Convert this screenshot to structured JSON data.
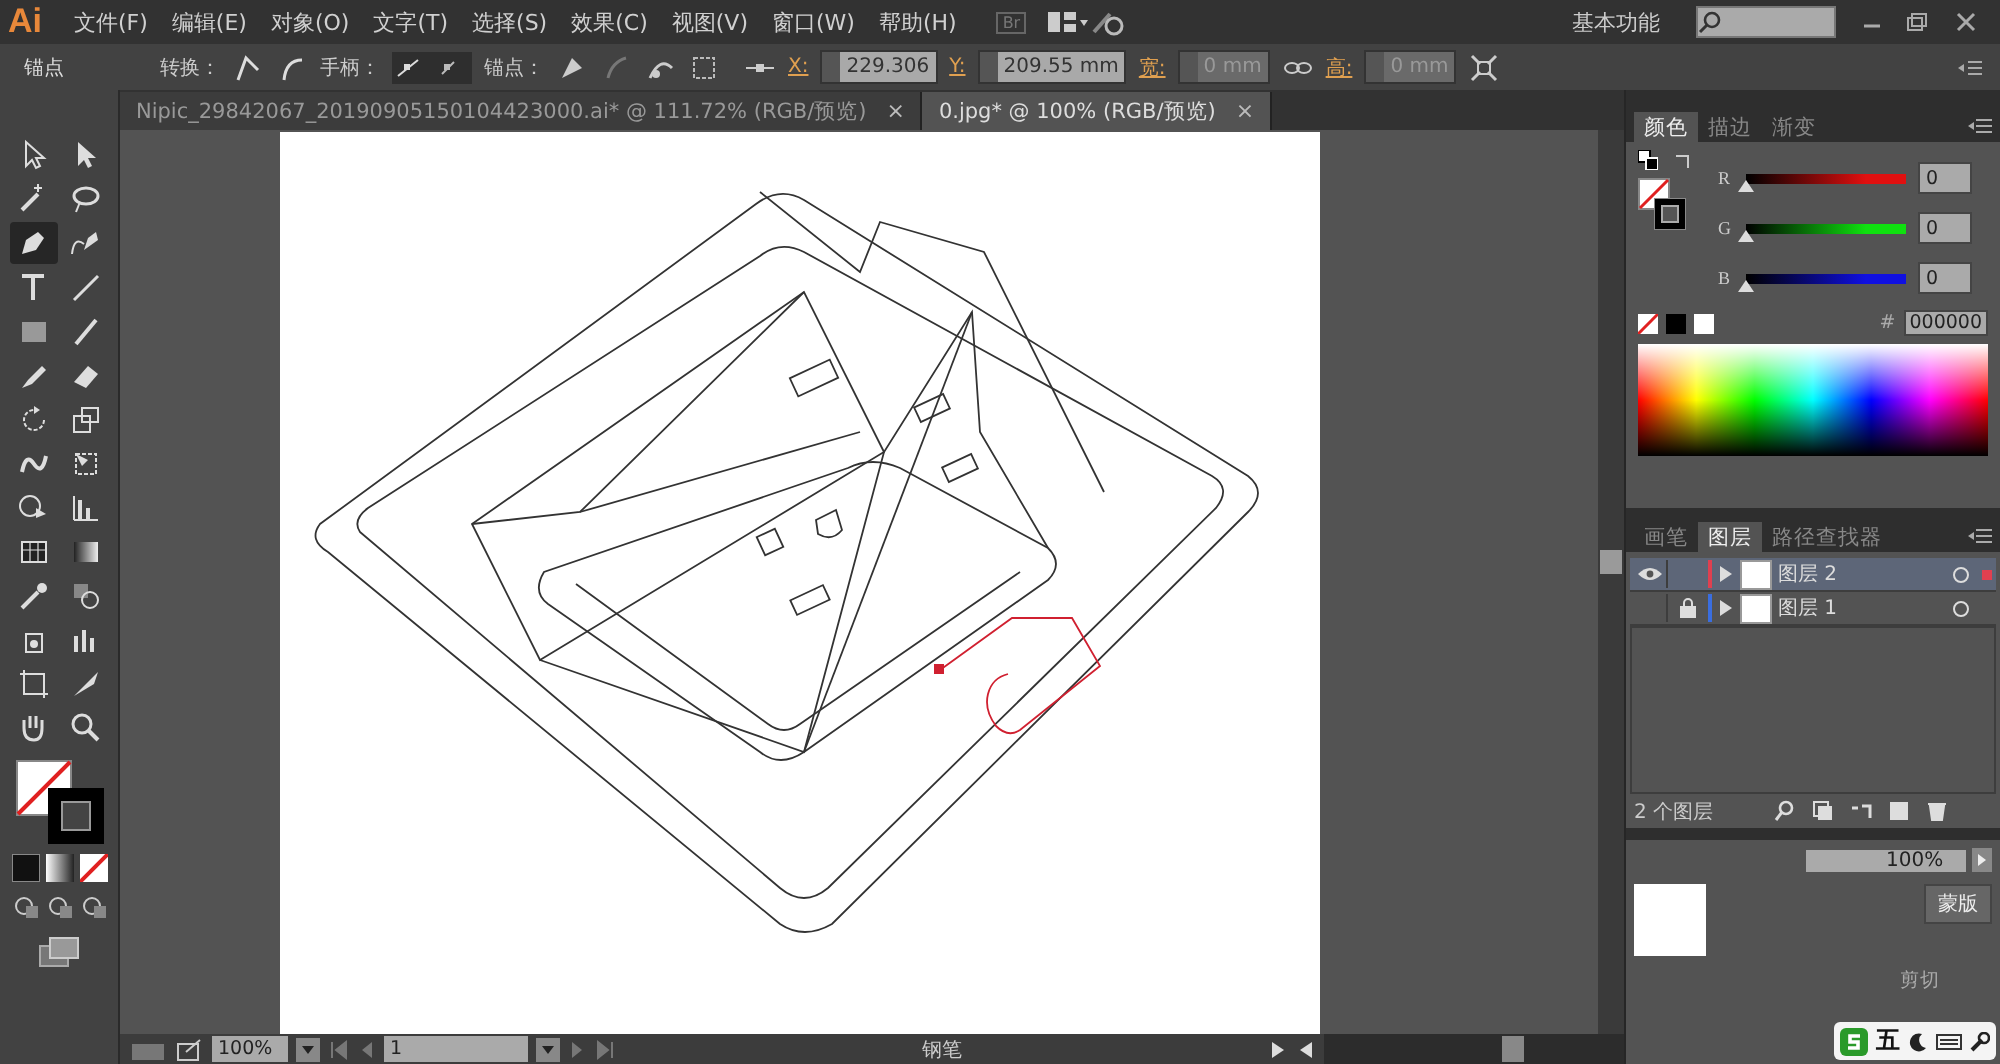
{
  "app": {
    "logo": "Ai",
    "menu": [
      "文件(F)",
      "编辑(E)",
      "对象(O)",
      "文字(T)",
      "选择(S)",
      "效果(C)",
      "视图(V)",
      "窗口(W)",
      "帮助(H)"
    ],
    "bridge": "Br",
    "workspace": "基本功能"
  },
  "control_bar": {
    "title": "锚点",
    "convert_label": "转换：",
    "handles_label": "手柄：",
    "anchor_label": "锚点：",
    "x_label": "X:",
    "x_value": "229.306",
    "y_label": "Y:",
    "y_value": "209.55 mm",
    "w_label": "宽:",
    "w_value": "0 mm",
    "h_label": "高:",
    "h_value": "0 mm"
  },
  "doc_tabs": [
    {
      "title": "Nipic_29842067_20190905150104423000.ai* @ 111.72% (RGB/预览)",
      "close": "×",
      "selected": false
    },
    {
      "title": "0.jpg* @ 100% (RGB/预览)",
      "close": "×",
      "selected": true
    }
  ],
  "tools": [
    {
      "selected": false
    },
    {
      "selected": false
    },
    {
      "selected": false
    },
    {
      "selected": false
    },
    {
      "selected": true
    },
    {
      "selected": false
    },
    {
      "selected": false
    },
    {
      "selected": false
    },
    {
      "selected": false
    },
    {
      "selected": false
    },
    {
      "selected": false
    },
    {
      "selected": false
    },
    {
      "selected": false
    },
    {
      "selected": false
    },
    {
      "selected": false
    },
    {
      "selected": false
    },
    {
      "selected": false
    },
    {
      "selected": false
    },
    {
      "selected": false
    },
    {
      "selected": false
    },
    {
      "selected": false
    },
    {
      "selected": false
    },
    {
      "selected": false
    },
    {
      "selected": false
    },
    {
      "selected": false
    },
    {
      "selected": false
    },
    {
      "selected": false
    },
    {
      "selected": false
    }
  ],
  "color_panel": {
    "tabs": [
      {
        "label": "颜色",
        "selected": true
      },
      {
        "label": "描边",
        "selected": false
      },
      {
        "label": "渐变",
        "selected": false
      }
    ],
    "channels": [
      {
        "name": "R",
        "color": "#e01010",
        "level": 0,
        "value": "0"
      },
      {
        "name": "G",
        "color": "#10e010",
        "level": 0,
        "value": "0"
      },
      {
        "name": "B",
        "color": "#1010e0",
        "level": 0,
        "value": "0"
      }
    ],
    "hex_label": "#",
    "hex_value": "000000"
  },
  "layers_panel": {
    "tabs": [
      {
        "label": "画笔",
        "selected": false
      },
      {
        "label": "图层",
        "selected": true
      },
      {
        "label": "路径查找器",
        "selected": false
      }
    ],
    "layers": [
      {
        "name": "图层 2",
        "visible": true,
        "locked": false,
        "color": "#e04050",
        "selected": true
      },
      {
        "name": "图层 1",
        "visible": false,
        "locked": true,
        "color": "#3a6ee0",
        "selected": false
      }
    ],
    "count": "2 个图层"
  },
  "transparency_panel": {
    "opacity": "100%",
    "mask_button": "蒙版",
    "clip_label": "剪切"
  },
  "ime_bar": {
    "mode": "五"
  },
  "status_bar": {
    "zoom": "100%",
    "page": "1",
    "tool": "钢笔"
  }
}
